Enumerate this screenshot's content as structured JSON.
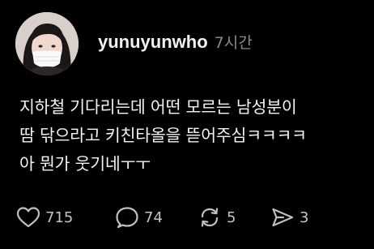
{
  "post": {
    "username": "yunuyunwho",
    "timestamp": "7시간",
    "lines": [
      "지하철 기다리는데 어떤 모르는 남성분이",
      "땀 닦으라고 키친타올을 뜯어주심ㅋㅋㅋㅋ",
      "아 뭔가 웃기네ㅜㅜ"
    ]
  },
  "actions": {
    "likes": "715",
    "comments": "74",
    "reposts": "5",
    "shares": "3"
  },
  "icons": {
    "like": "heart-icon",
    "comment": "speech-bubble-icon",
    "repost": "repost-arrows-icon",
    "share": "send-icon"
  },
  "colors": {
    "background": "#000000",
    "text": "#f4f4f4",
    "muted": "#8a8a8a",
    "icon": "#b5b5b5"
  }
}
